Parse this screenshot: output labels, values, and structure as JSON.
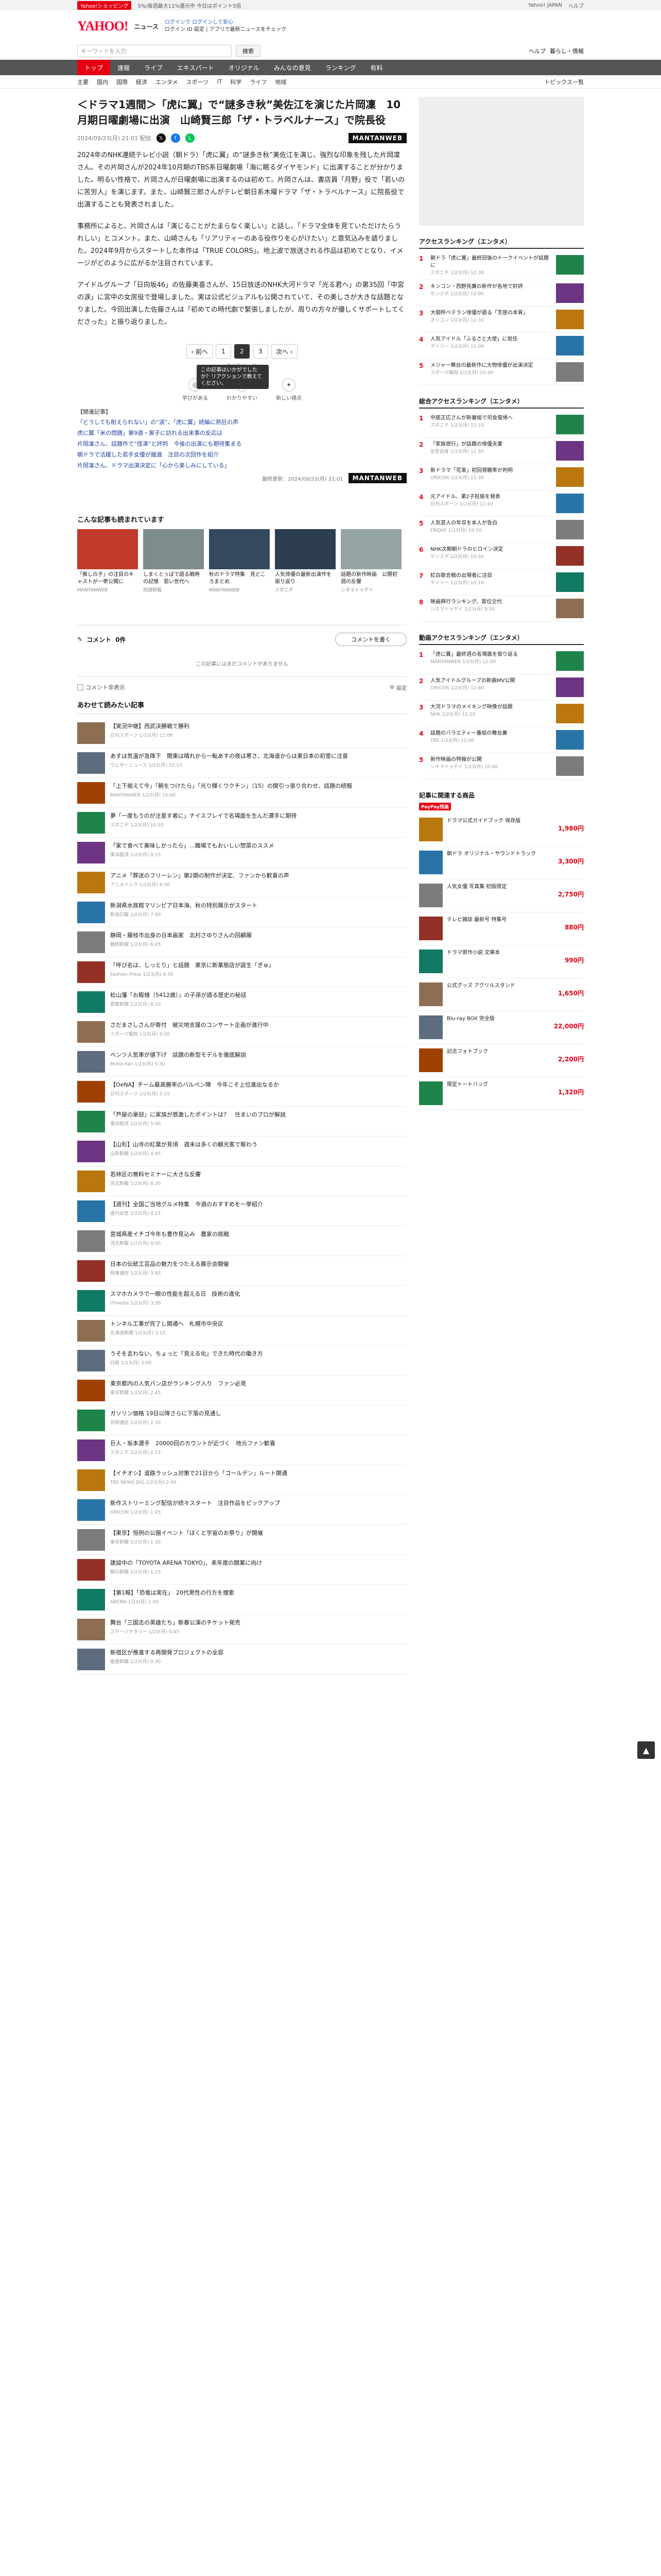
{
  "topbar": {
    "promo": "Yahoo!ショッピング",
    "text1": "5%/毎週最大11%還元中 今日はポイント5倍",
    "right_links": [
      "Yahoo! JAPAN",
      "ヘルプ"
    ]
  },
  "header": {
    "logo": "YAHOO!",
    "logo_sub": "ニュース",
    "line1": "ログインで ログインして安心",
    "line2": "ログイン ID 設定 | アプリで最新ニュースをチェック"
  },
  "search": {
    "placeholder": "キーワードを入力",
    "button": "検索",
    "right1": "ヘルプ",
    "right2": "暮らし・情報"
  },
  "nav": {
    "items": [
      "トップ",
      "速報",
      "ライブ",
      "エキスパート",
      "オリジナル",
      "みんなの意見",
      "ランキング",
      "有料"
    ],
    "right": "•"
  },
  "subnav": {
    "items": [
      "主要",
      "国内",
      "国際",
      "経済",
      "エンタメ",
      "スポーツ",
      "IT",
      "科学",
      "ライフ",
      "地域"
    ],
    "right": "トピックス一覧"
  },
  "article": {
    "title": "＜ドラマ1週間＞「虎に翼」で“謎多き秋”美佐江を演じた片岡凜　10月期日曜劇場に出演　山崎賢三郎「ザ・トラベルナース」で院長役",
    "date": "2024/09/23(月) 21:01 配信",
    "brand": "MANTANWEB",
    "paragraphs": [
      "2024年のNHK連続テレビ小説（朝ドラ）「虎に翼」の“謎多き秋”美佐江を演じ、強烈な印象を残した片岡凜さん。その片岡さんが2024年10月期のTBS系日曜劇場「海に眠るダイヤモンド」に出演することが分かりました。明るい性格で、片岡さんが日曜劇場に出演するのは初めて。片岡さんは、書店員「月野」役で「若いのに苦労人」を演じます。また、山崎賢三郎さんがテレビ朝日系木曜ドラマ「ザ・トラベルナース」に院長役で出演することも発表されました。",
      "事務所によると、片岡さんは「演じることがたまらなく楽しい」と話し、「ドラマ全体を見ていただけたらうれしい」とコメント。また、山崎さんも「リアリティーのある役作りを心がけたい」と意気込みを語りました。2024年9月からスタートした本作は「TRUE COLORS」。地上波で放送される作品は初めてとなり、イメージがどのように広がるか注目されています。",
      "アイドルグループ「日向坂46」の佐藤美喜さんが、15日放送のNHK大河ドラマ「光る君へ」の第35回「中宮の涙」に宮中の女房役で登場しました。実は公式ビジュアルも公開されていて、その美しさが大きな話題となりました。今回出演した佐藤さんは「初めての時代劇で緊張しましたが、周りの方々が優しくサポートしてくださった」と振り返りました。"
    ]
  },
  "pager": {
    "prev": "‹ 前へ",
    "pages": [
      "1",
      "2",
      "3"
    ],
    "current": "2",
    "next": "次へ ›",
    "note": "2 / 3ページ"
  },
  "reactions": {
    "tooltip": "この記事はいかがでしたか？リアクションで教えてください。",
    "items": [
      {
        "label": "学びがある",
        "icon": "◎"
      },
      {
        "label": "わかりやすい",
        "icon": "☺"
      },
      {
        "label": "新しい視点",
        "icon": "✦"
      }
    ]
  },
  "related": {
    "label": "【関連記事】",
    "links": [
      "「どうしても耐えられない」の“涙”、「虎に翼」続編に熱狂の声",
      "虎に翼「米の問題」第9週・寅子に訪れる出来事の反応は",
      "片岡凜さん、話題作で“怪演”と評判　今後の出演にも期待集まる",
      "朝ドラで活躍した若手女優が躍進　注目の次回作を紹介",
      "片岡凜さん、ドラマ出演決定に「心から楽しみにしている」"
    ]
  },
  "byline": {
    "updated": "最終更新：2024/09/23(月) 21:01",
    "source": "MANTANWEB"
  },
  "recommend": {
    "title": "こんな記事も読まれています",
    "cards": [
      {
        "text": "「推しの子」の注目のキャストが一挙公開に",
        "src": "MANTANWEB"
      },
      {
        "text": "しまくとぅばで語る戦時の記憶　若い世代へ",
        "src": "琉球新報"
      },
      {
        "text": "秋のドラマ特集　見どころまとめ",
        "src": "MANTANWEB"
      },
      {
        "text": "人気俳優の最新出演作を振り返り",
        "src": "スポニチ"
      },
      {
        "text": "話題の新作映画　公開初週の反響",
        "src": "シネマトゥデイ"
      }
    ]
  },
  "comments": {
    "title": "コメント",
    "count": "0件",
    "post": "コメントを書く",
    "note": "この記事にはまだコメントがありません",
    "filter": "コメント非表示",
    "settings": "設定"
  },
  "feed": {
    "title": "あわせて読みたい記事",
    "items": [
      {
        "text": "【実況中継】西武決勝戦で勝利",
        "src": "日刊スポーツ 1/23(月) 11:06"
      },
      {
        "text": "あすは気温が急降下　関東は晴れから一転あすの夜は寒さ、北海道からは東日本の初雪に注意",
        "src": "ウェザーニュース 1/23(月) 12:13"
      },
      {
        "text": "「上下揃えて今」「朝をつけたら」「光り輝くワクチン」（15）の開引っ張り合わせ、話題の続報",
        "src": "MANTANWEB 1/23(月) 10:00"
      },
      {
        "text": "夢「一度もうのが注意す者に」ナイスプレイで名場面を生んだ選手に期待",
        "src": "スポニチ 1/23(月) 10:55"
      },
      {
        "text": "「家で食べて美味しかったら」…職場でもおいしい惣菜のススメ",
        "src": "東洋経済 1/23(月) 9:15"
      },
      {
        "text": "アニメ「葬送のフリーレン」第2期の制作が決定、ファンから歓喜の声",
        "src": "アニメハック 1/23(月) 8:30"
      },
      {
        "text": "新潟県水族館マリンピア日本海、秋の特別展示がスタート",
        "src": "新潟日報 1/23(月) 7:00"
      },
      {
        "text": "静岡・藤枝市出身の日本画家　北村さゆりさんの回顧展",
        "src": "静岡新聞 1/23(月) 6:45"
      },
      {
        "text": "「呼び名は、しっとり」と話題　東京に新業態店が誕生「ぎゅ」",
        "src": "Fashion Press 1/23(月) 6:30"
      },
      {
        "text": "松山藩「お殿様（5412歳）」の子孫が語る歴史の秘話",
        "src": "愛媛新聞 1/23(月) 6:10"
      },
      {
        "text": "さだまさしさんが寄付　被災地支援のコンサート企画が進行中",
        "src": "スポーツ報知 1/23(月) 5:50"
      },
      {
        "text": "ベンツ人気車が値下げ　話題の新型モデルを徹底解説",
        "src": "Motor-Fan 1/23(月) 5:30"
      },
      {
        "text": "【OeNA】チーム最高勝率のバルペン陣　今年こそ上位進出なるか",
        "src": "日刊スポーツ 1/23(月) 5:15"
      },
      {
        "text": "「芦屋の豪邸」に家族が感激したポイントは？　住まいのプロが解説",
        "src": "東洋経済 1/23(月) 5:00"
      },
      {
        "text": "【山形】山寺の紅葉が見頃　週末は多くの観光客で賑わう",
        "src": "山形新聞 1/23(月) 4:45"
      },
      {
        "text": "若林区の無料セミナーに大きな反響",
        "src": "河北新報 1/23(月) 4:30"
      },
      {
        "text": "【週刊】全国ご当地グルメ特集　今週のおすすめを一挙紹介",
        "src": "週刊女性 1/23(月) 4:15"
      },
      {
        "text": "宮城県産イチゴ今年も豊作見込み　農家の挑戦",
        "src": "河北新報 1/23(月) 4:00"
      },
      {
        "text": "日本の伝統工芸品の魅力をつたえる展示会開催",
        "src": "時事通信 1/23(月) 3:45"
      },
      {
        "text": "スマホカメラで一眼の性能を超える日　技術の進化",
        "src": "ITmedia 1/23(月) 3:30"
      },
      {
        "text": "トンネル工事が完了し開通へ　札幌市中央区",
        "src": "北海道新聞 1/23(月) 3:15"
      },
      {
        "text": "うそを言わない、ちょっと「見える化」できた時代の働き方",
        "src": "日経 1/23(月) 3:00"
      },
      {
        "text": "東京都内の人気パン店がランキング入り　ファン必見",
        "src": "東京新聞 1/23(月) 2:45"
      },
      {
        "text": "ガソリン価格 19日以降さらに下落の見通し",
        "src": "共同通信 1/23(月) 2:30"
      },
      {
        "text": "巨人・坂本選手　20000回のカウントが近づく　地元ファン歓喜",
        "src": "スポニチ 1/23(月) 2:15"
      },
      {
        "text": "【イチオシ】道路ラッシュ対策で21日から「ゴールデン」ルート開通",
        "src": "TBS NEWS DIG 1/23(月) 2:00"
      },
      {
        "text": "新作ストリーミング配信が続々スタート　注目作品をピックアップ",
        "src": "ORICON 1/23(月) 1:45"
      },
      {
        "text": "【東京】恒例の公園イベント「ぼくと宇宙のお祭り」が開催",
        "src": "東京新聞 1/23(月) 1:30"
      },
      {
        "text": "建設中の「TOYOTA ARENA TOKYO」、来年度の開業に向け",
        "src": "朝日新聞 1/23(月) 1:15"
      },
      {
        "text": "【第1報】「恐竜は実在」　20代男性の行方を捜索",
        "src": "ABEMA 1/23(月) 1:00"
      },
      {
        "text": "舞台「三国志の英雄たち」新春公演のチケット発売",
        "src": "ステージナタリー 1/23(月) 0:45"
      },
      {
        "text": "新宿区が推進する再開発プロジェクトの全容",
        "src": "産経新聞 1/23(月) 0:30"
      }
    ]
  },
  "side": {
    "rank1_title": "アクセスランキング（エンタメ）",
    "rank1": [
      {
        "text": "朝ドラ「虎に翼」最終回後のトークイベントが話題に",
        "src": "スポニチ 1/23(月) 12:30"
      },
      {
        "text": "キンコン・西野亮廣の新作が各地で好評",
        "src": "サンスポ 1/23(月) 12:00"
      },
      {
        "text": "大御所ベテラン俳優が語る「芝居の本質」",
        "src": "オリコン 1/23(月) 11:30"
      },
      {
        "text": "人気アイドル「ふるさと大使」に就任",
        "src": "デイリー 1/23(月) 11:00"
      },
      {
        "text": "メジャー舞台の最新作に大物俳優が出演決定",
        "src": "スポーツ報知 1/23(月) 10:30"
      }
    ],
    "rank2_title": "総合アクセスランキング（エンタメ）",
    "rank2": [
      {
        "text": "中居正広さんが新番組で司会復帰へ",
        "src": "スポニチ 1/23(月) 12:10"
      },
      {
        "text": "「家族旅行」が話題の俳優夫妻",
        "src": "女性自身 1/23(月) 11:50"
      },
      {
        "text": "新ドラマ「花束」初回視聴率が判明",
        "src": "ORICON 1/23(月) 11:30"
      },
      {
        "text": "元アイドル、第2子妊娠を発表",
        "src": "日刊スポーツ 1/23(月) 11:10"
      },
      {
        "text": "人気芸人の年収を本人が告白",
        "src": "FRIDAY 1/23(月) 10:50"
      },
      {
        "text": "NHK次期朝ドラのヒロイン決定",
        "src": "サンスポ 1/23(月) 10:30"
      },
      {
        "text": "紅白歌合戦の出場者に注目",
        "src": "デイリー 1/23(月) 10:10"
      },
      {
        "text": "映画興行ランキング、首位交代",
        "src": "シネマトゥデイ 1/23(月) 9:50"
      }
    ],
    "rank3_title": "動画アクセスランキング（エンタメ）",
    "rank3": [
      {
        "text": "「虎に翼」最終週の名場面を振り返る",
        "src": "MANTANWEB 1/23(月) 12:00"
      },
      {
        "text": "人気アイドルグループの新曲MV公開",
        "src": "ORICON 1/23(月) 11:40"
      },
      {
        "text": "大河ドラマのメイキング映像が話題",
        "src": "NHK 1/23(月) 11:20"
      },
      {
        "text": "話題のバラエティー番組の舞台裏",
        "src": "TBS 1/23(月) 11:00"
      },
      {
        "text": "新作映画の特報が公開",
        "src": "シネマトゥデイ 1/23(月) 10:40"
      }
    ],
    "shop_title": "記事に関連する商品",
    "shop_badge": "PayPay残高",
    "shop": [
      {
        "text": "ドラマ公式ガイドブック 保存版",
        "price": "1,980円"
      },
      {
        "text": "朝ドラ オリジナル・サウンドトラック",
        "price": "3,300円"
      },
      {
        "text": "人気女優 写真集 初版限定",
        "price": "2,750円"
      },
      {
        "text": "テレビ雑誌 最新号 特集号",
        "price": "880円"
      },
      {
        "text": "ドラマ原作小説 文庫本",
        "price": "990円"
      },
      {
        "text": "公式グッズ アクリルスタンド",
        "price": "1,650円"
      },
      {
        "text": "Blu-ray BOX 完全版",
        "price": "22,000円"
      },
      {
        "text": "記念フォトブック",
        "price": "2,200円"
      },
      {
        "text": "限定トートバッグ",
        "price": "1,320円"
      }
    ]
  },
  "icons": {
    "to_top": "to-top-icon"
  }
}
